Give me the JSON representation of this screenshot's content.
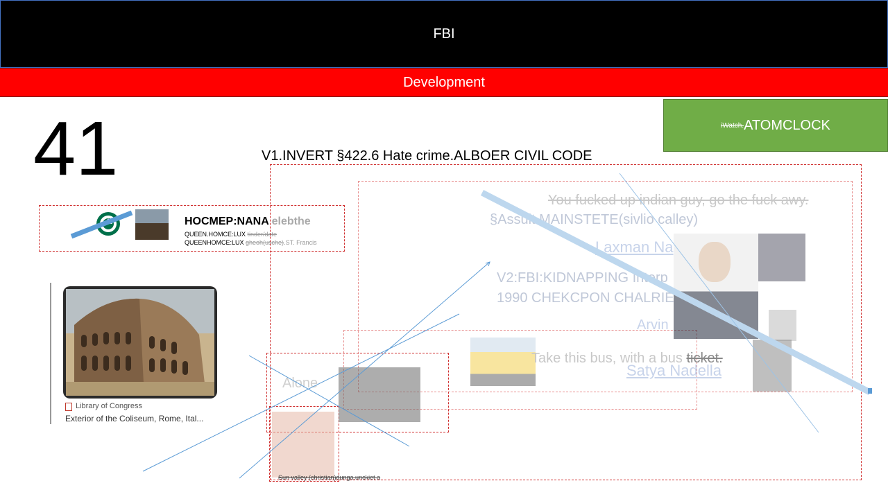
{
  "header": {
    "title": "FBI"
  },
  "subheader": {
    "title": "Development"
  },
  "slide": {
    "number": "41"
  },
  "badge": {
    "small": "iWatch.",
    "label": "ATOMCLOCK"
  },
  "title_line": "V1.INVERT §422.6 Hate crime.ALBOER CIVIL CODE",
  "card": {
    "title": "HOCMEP:NANA",
    "title_faded": " elebthe",
    "line1_prefix": "QUEEN.HOMCE:LUX ",
    "line1_strike": "tinder/date",
    "line2_prefix": "QUEENHOMCE:LUX ",
    "line2_strike": "gheoh(usche)",
    "line2_suffix": ".ST. Francis"
  },
  "coliseum": {
    "source": "Library of Congress",
    "caption": "Exterior of the Coliseum, Rome, Ital..."
  },
  "overlay": {
    "abuse": "You fucked up indian guy, go the fuck awy.",
    "assult": "§Assult MAINSTETE(sivlio calley)",
    "laxman": "Laxman Na",
    "v2": "V2:FBI:KIDNAPPING Interp",
    "checkpoint": "1990 CHEKCPON CHALRIE",
    "arvin": "Arvin",
    "bus_prefix": "Take this bus, with a bus ",
    "bus_strike": "ticket.",
    "satya": "Satya Nadella",
    "alone": "Alone",
    "small_caption": "Sun valley (christian)dunga.unckiet a"
  },
  "colors": {
    "header_bg": "#000000",
    "subheader_bg": "#ff0000",
    "badge_bg": "#70ad47",
    "dashed_border": "#d03030",
    "line_blue": "#5b9bd5"
  },
  "icons": [
    "starbucks-logo-icon",
    "library-of-congress-icon"
  ]
}
